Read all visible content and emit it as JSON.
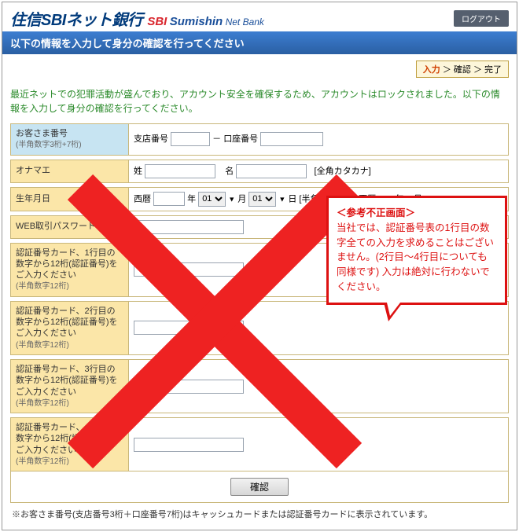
{
  "header": {
    "logo_jp": "住信SBIネット銀行",
    "logo_en1": "SBI",
    "logo_en2": "Sumishin",
    "logo_en3": "Net Bank",
    "logout": "ログアウト"
  },
  "bluebar": "以下の情報を入力して身分の確認を行ってください",
  "steps": {
    "s1": "入力",
    "sep1": "＞",
    "s2": "確認",
    "sep2": "＞",
    "s3": "完了"
  },
  "warning": "最近ネットでの犯罪活動が盛んでおり、アカウント安全を確保するため、アカウントはロックされました。以下の情報を入力して身分の確認を行ってください。",
  "form": {
    "customer_no": {
      "label": "お客さま番号",
      "sub": "(半角数字3桁+7桁)",
      "branch": "支店番号",
      "dash": "－",
      "account": "口座番号"
    },
    "name": {
      "label": "オナマエ",
      "sei": "姓",
      "mei": "名",
      "note": "[全角カタカナ]"
    },
    "dob": {
      "label": "生年月日",
      "era": "西暦",
      "y": "年",
      "m_opt": "01",
      "m": "月",
      "d_opt": "01",
      "d": "日",
      "note": "[半角数字](例：西暦1982年09月"
    },
    "webpw": {
      "label": "WEB取引パスワード"
    },
    "card1": {
      "label": "認証番号カード、1行目の数字から12桁(認証番号)をご入力ください",
      "sub": "(半角数字12桁)"
    },
    "card2": {
      "label": "認証番号カード、2行目の数字から12桁(認証番号)をご入力ください",
      "sub": "(半角数字12桁)"
    },
    "card3": {
      "label": "認証番号カード、3行目の数字から12桁(認証番号)をご入力ください",
      "sub": "(半角数字12桁)"
    },
    "card4": {
      "label": "認証番号カード、4行目の数字から12桁(認証番号)をご入力ください",
      "sub": "(半角数字12桁)"
    }
  },
  "confirm": "確認",
  "footnote": "※お客さま番号(支店番号3桁＋口座番号7桁)はキャッシュカードまたは認証番号カードに表示されています。",
  "bubble": {
    "title": "＜参考不正画面＞",
    "body": "当社では、認証番号表の1行目の数字全ての入力を求めることはございません。(2行目～4行目についても同様です)\n入力は絶対に行わないでください。"
  }
}
